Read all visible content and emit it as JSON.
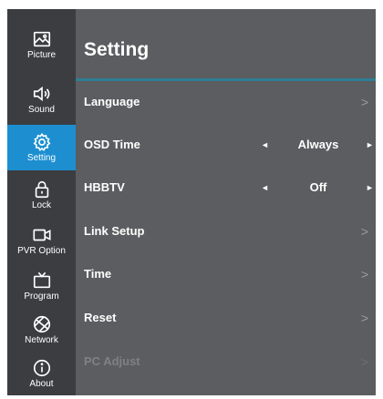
{
  "sidebar": {
    "items": [
      {
        "label": "Picture",
        "icon": "picture-icon"
      },
      {
        "label": "Sound",
        "icon": "speaker-icon"
      },
      {
        "label": "Setting",
        "icon": "gear-icon",
        "active": true
      },
      {
        "label": "Lock",
        "icon": "lock-icon"
      },
      {
        "label": "PVR Option",
        "icon": "video-camera-icon"
      },
      {
        "label": "Program",
        "icon": "tv-icon"
      },
      {
        "label": "Network",
        "icon": "globe-icon"
      },
      {
        "label": "About",
        "icon": "info-icon"
      }
    ]
  },
  "main": {
    "title": "Setting",
    "rows": [
      {
        "label": "Language",
        "type": "submenu"
      },
      {
        "label": "OSD Time",
        "type": "option",
        "value": "Always"
      },
      {
        "label": "HBBTV",
        "type": "option",
        "value": "Off"
      },
      {
        "label": "Link Setup",
        "type": "submenu"
      },
      {
        "label": "Time",
        "type": "submenu"
      },
      {
        "label": "Reset",
        "type": "submenu"
      },
      {
        "label": "PC Adjust",
        "type": "submenu",
        "disabled": true
      }
    ],
    "chevron": ">",
    "left_arrow": "◄",
    "right_arrow": "►"
  },
  "colors": {
    "sidebar_bg": "#3b3d40",
    "panel_bg": "#5b5d60",
    "active": "#1d8fd1",
    "title_underline": "#2d7e95"
  }
}
